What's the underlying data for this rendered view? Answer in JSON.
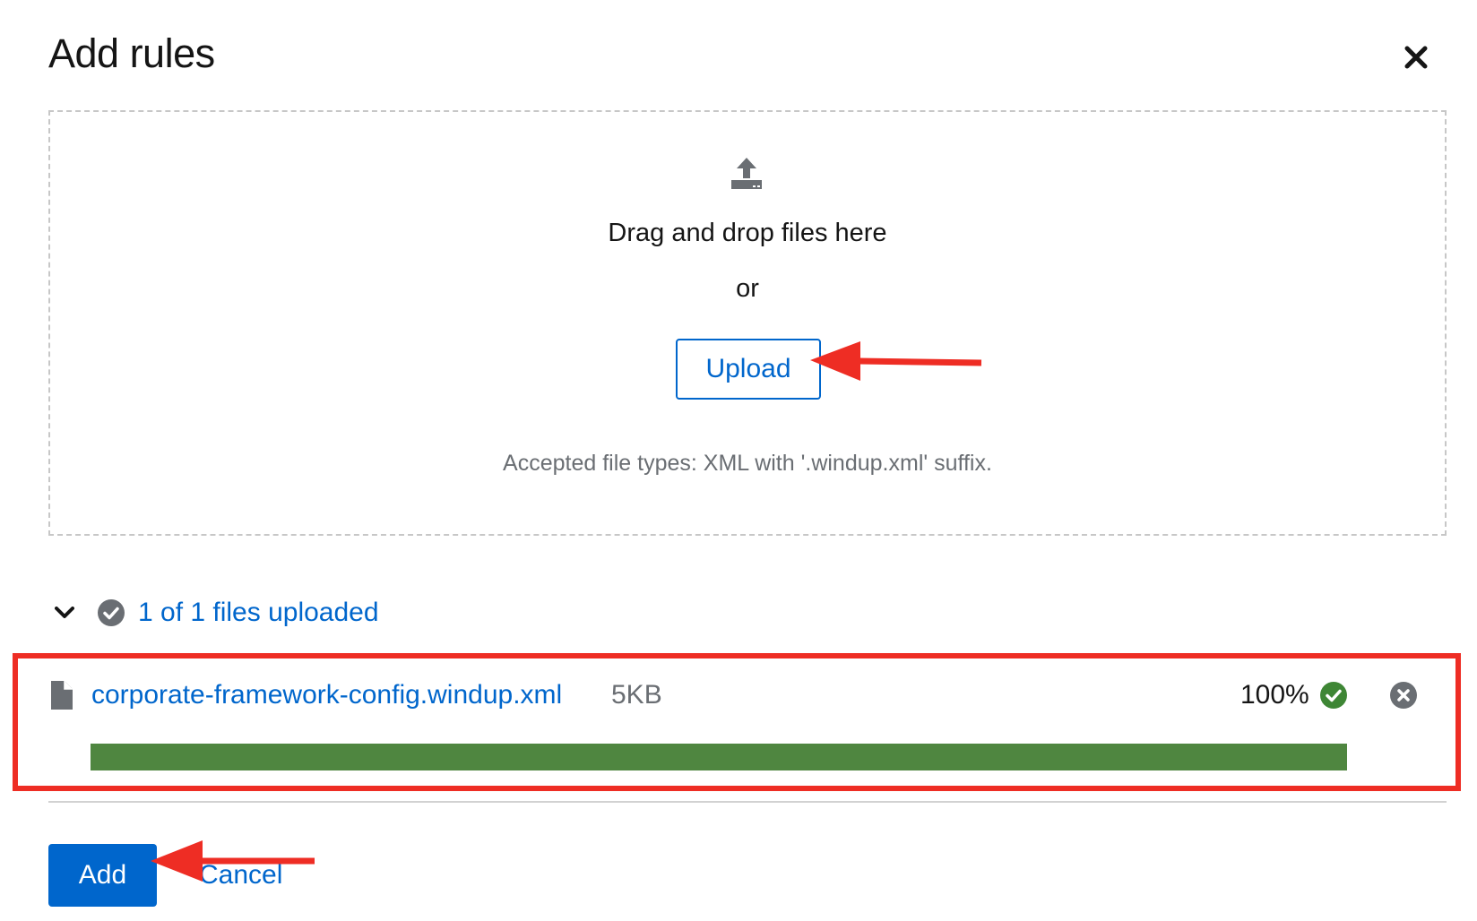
{
  "modal": {
    "title": "Add rules",
    "close_icon": "close-icon"
  },
  "dropzone": {
    "icon": "upload-icon",
    "drag_text": "Drag and drop files here",
    "or_text": "or",
    "upload_label": "Upload",
    "accepted_text": "Accepted file types: XML with '.windup.xml' suffix."
  },
  "status": {
    "icon": "check-circle-icon",
    "text": "1 of 1 files uploaded",
    "expanded": true
  },
  "files": [
    {
      "name": "corporate-framework-config.windup.xml",
      "size": "5KB",
      "progress_label": "100%",
      "progress": 1.0,
      "state": "success"
    }
  ],
  "footer": {
    "add_label": "Add",
    "cancel_label": "Cancel"
  },
  "colors": {
    "primary": "#0066cc",
    "success": "#3e8635",
    "progress": "#4f8640",
    "annotation": "#ee2d24",
    "muted": "#6a6e73"
  }
}
